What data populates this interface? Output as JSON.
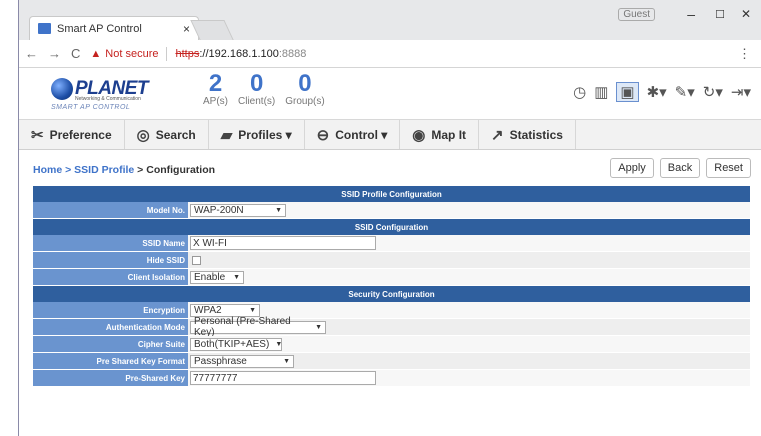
{
  "browser": {
    "tab_title": "Smart AP Control",
    "tab_close": "×",
    "user": "Guest",
    "win_min": "–",
    "win_max": "☐",
    "win_close": "✕",
    "back": "←",
    "forward": "→",
    "reload": "C",
    "warn_icon": "▲",
    "not_secure": "Not secure",
    "url_https": "https",
    "url_host": "://192.168.1.100",
    "url_port": ":8888",
    "menu": "⋮"
  },
  "header": {
    "brand": "PLANET",
    "brand_sub": "Networking & Communication",
    "brand_tag": "SMART AP CONTROL",
    "counts": [
      {
        "num": "2",
        "label": "AP(s)"
      },
      {
        "num": "0",
        "label": "Client(s)"
      },
      {
        "num": "0",
        "label": "Group(s)"
      }
    ]
  },
  "menubar": {
    "items": [
      {
        "label": "Preference",
        "icon": "wrench-icon"
      },
      {
        "label": "Search",
        "icon": "search-icon"
      },
      {
        "label": "Profiles",
        "icon": "folder-icon",
        "dropdown": true
      },
      {
        "label": "Control",
        "icon": "control-icon",
        "dropdown": true
      },
      {
        "label": "Map It",
        "icon": "map-pin-icon"
      },
      {
        "label": "Statistics",
        "icon": "chart-line-icon"
      }
    ],
    "profiles_label": "Profiles ▾",
    "control_label": "Control ▾"
  },
  "breadcrumb": {
    "home": "Home",
    "sep1": " > ",
    "ssid_profile": "SSID Profile",
    "sep2": " > ",
    "current": "Configuration"
  },
  "actions": {
    "apply": "Apply",
    "back": "Back",
    "reset": "Reset"
  },
  "sections": {
    "profile": "SSID Profile Configuration",
    "ssid": "SSID Configuration",
    "security": "Security Configuration"
  },
  "fields": {
    "model_label": "Model No.",
    "model_value": "WAP-200N",
    "ssid_label": "SSID Name",
    "ssid_value": "X WI-FI",
    "hide_label": "Hide SSID",
    "isolation_label": "Client Isolation",
    "isolation_value": "Enable",
    "encryption_label": "Encryption",
    "encryption_value": "WPA2",
    "auth_label": "Authentication Mode",
    "auth_value": "Personal (Pre-Shared Key)",
    "cipher_label": "Cipher Suite",
    "cipher_value": "Both(TKIP+AES)",
    "pskformat_label": "Pre Shared Key Format",
    "pskformat_value": "Passphrase",
    "psk_label": "Pre-Shared Key",
    "psk_value": "77777777"
  }
}
